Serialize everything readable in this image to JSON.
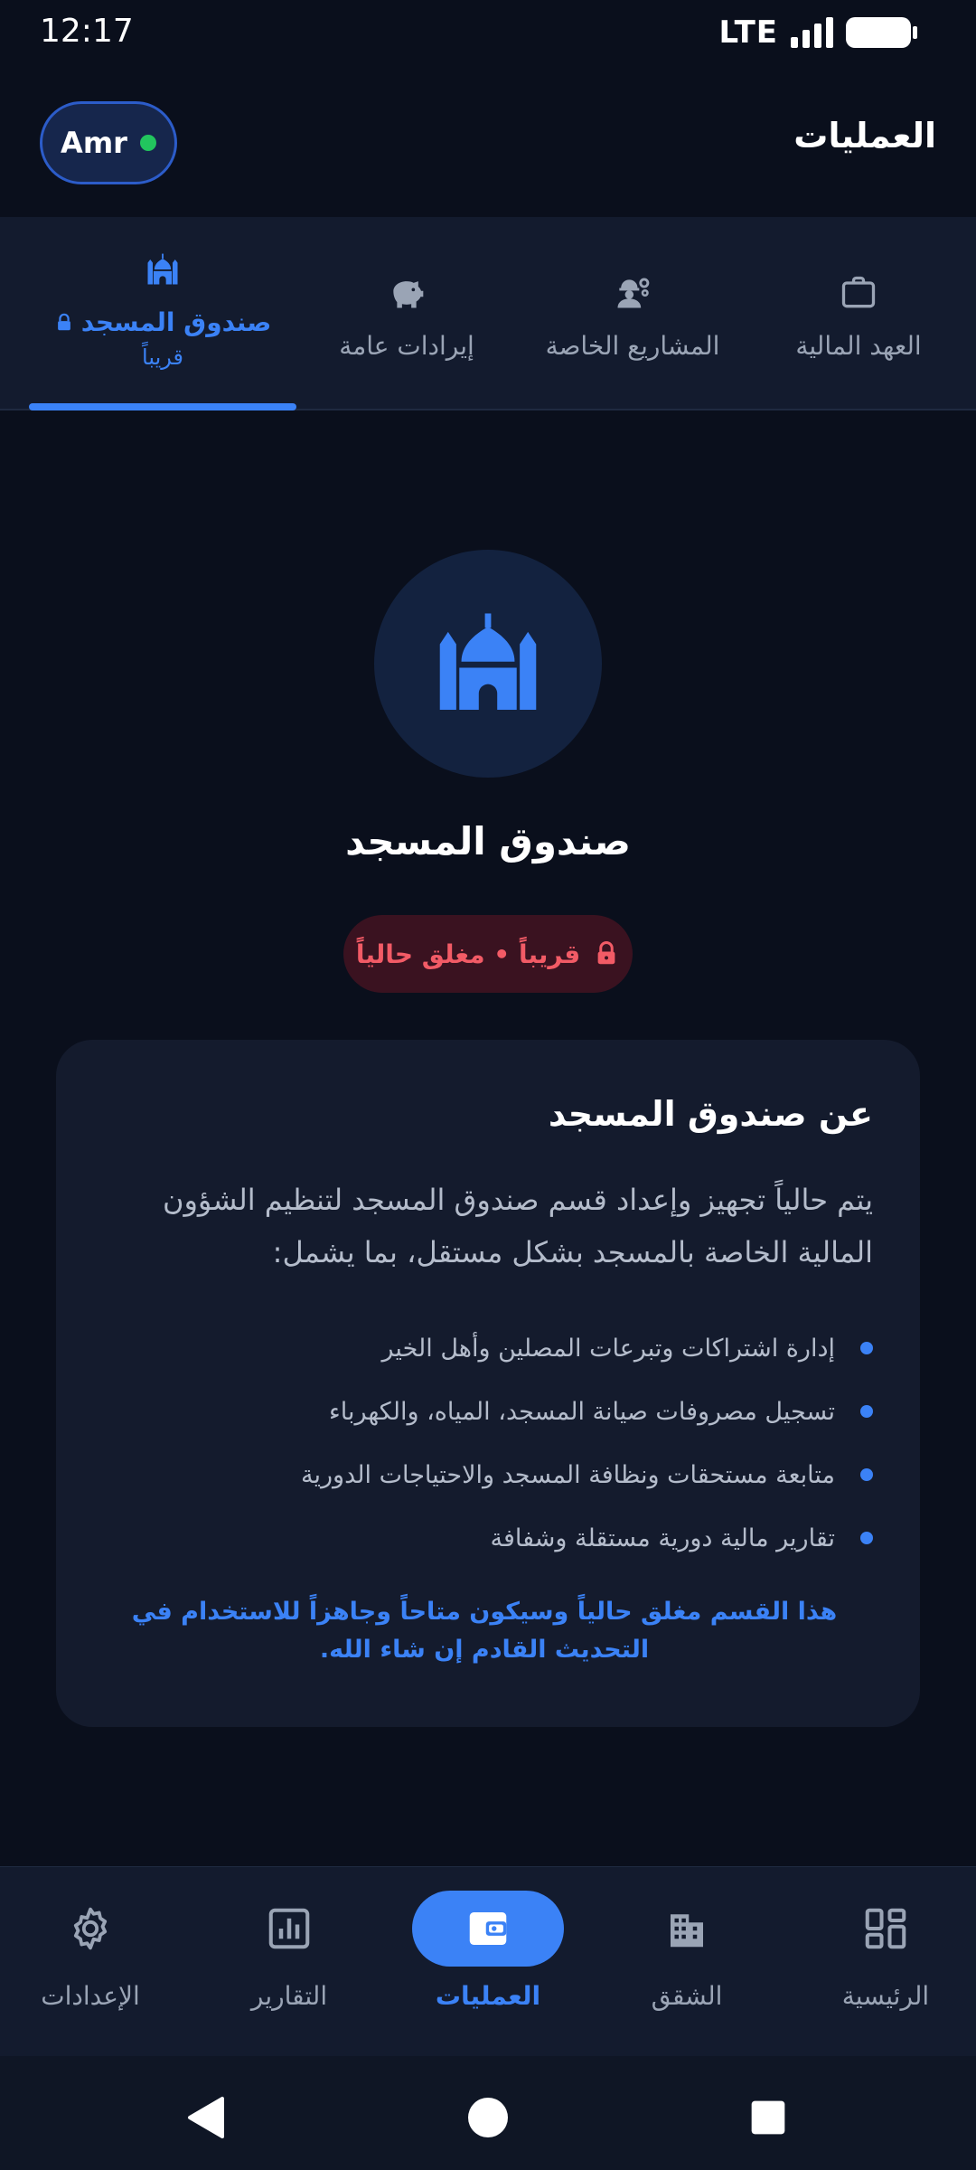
{
  "status_bar": {
    "time": "12:17",
    "network": "LTE"
  },
  "header": {
    "title": "العمليات",
    "user_name": "Amr"
  },
  "tabs": [
    {
      "label": "العهد المالية",
      "icon": "briefcase-icon"
    },
    {
      "label": "المشاريع الخاصة",
      "icon": "worker-gear-icon"
    },
    {
      "label": "إيرادات عامة",
      "icon": "piggy-bank-icon"
    },
    {
      "label": "صندوق المسجد",
      "sublabel": "قريباً",
      "icon": "mosque-icon",
      "locked": true,
      "active": true
    }
  ],
  "hero": {
    "icon": "mosque-icon",
    "title": "صندوق المسجد",
    "badge": "قريباً • مغلق حالياً"
  },
  "card": {
    "title": "عن صندوق المسجد",
    "description": "يتم حالياً تجهيز وإعداد قسم صندوق المسجد لتنظيم الشؤون المالية الخاصة بالمسجد بشكل مستقل، بما يشمل:",
    "items": [
      "إدارة اشتراكات وتبرعات المصلين وأهل الخير",
      "تسجيل مصروفات صيانة المسجد، المياه، والكهرباء",
      "متابعة مستحقات ونظافة المسجد والاحتياجات الدورية",
      "تقارير مالية دورية مستقلة وشفافة"
    ],
    "note": "هذا القسم مغلق حالياً وسيكون متاحاً وجاهزاً للاستخدام في التحديث القادم إن شاء الله."
  },
  "bottom_nav": [
    {
      "label": "الرئيسية",
      "icon": "dashboard-icon"
    },
    {
      "label": "الشقق",
      "icon": "building-icon"
    },
    {
      "label": "العمليات",
      "icon": "wallet-icon",
      "active": true
    },
    {
      "label": "التقارير",
      "icon": "chart-icon"
    },
    {
      "label": "الإعدادات",
      "icon": "settings-gear-icon"
    }
  ],
  "colors": {
    "background": "#0a0f1c",
    "surface": "#131b2e",
    "accent": "#3b82f6",
    "danger": "#f25b66",
    "online": "#22c55e"
  }
}
